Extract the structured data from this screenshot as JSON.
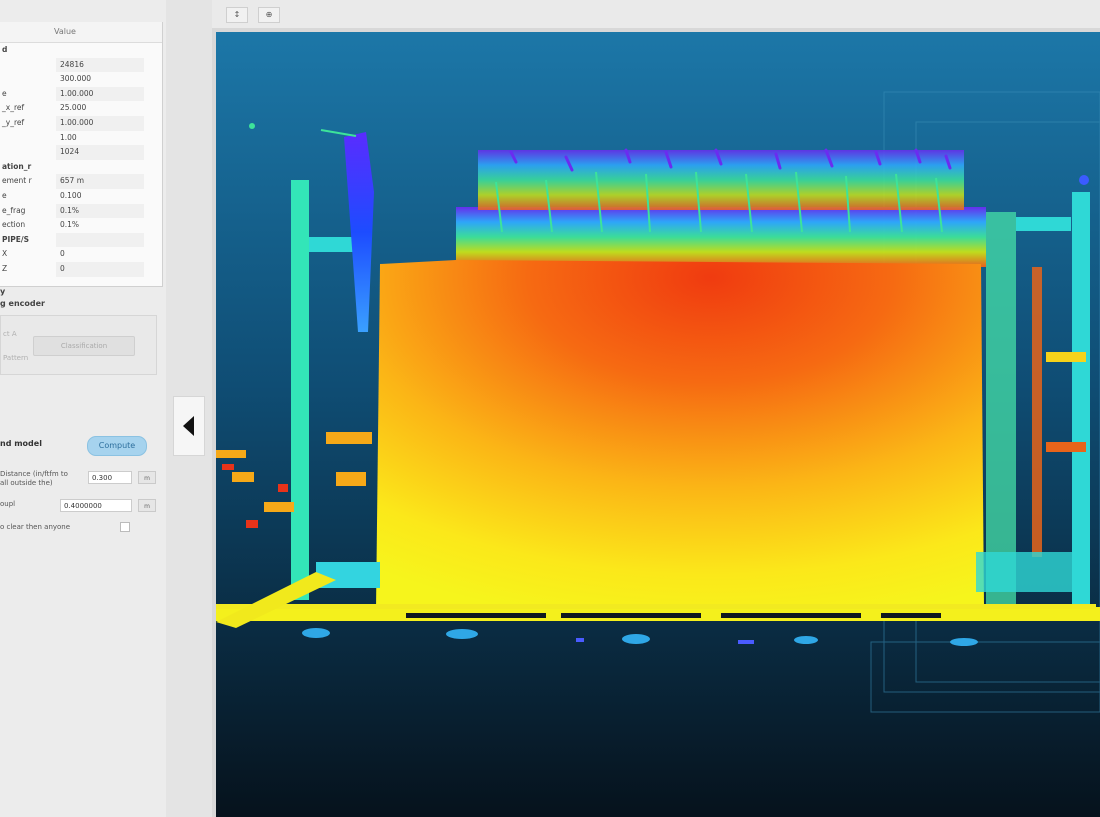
{
  "left_panel": {
    "title": "",
    "table": {
      "col_name": "",
      "col_value": "Value",
      "rows": [
        {
          "k": "d",
          "v": "",
          "section": true
        },
        {
          "k": "",
          "v": "24816"
        },
        {
          "k": "",
          "v": "300.000"
        },
        {
          "k": "e",
          "v": "1.00.000"
        },
        {
          "k": "_x_ref",
          "v": "25.000"
        },
        {
          "k": "_y_ref",
          "v": "1.00.000"
        },
        {
          "k": "",
          "v": "1.00"
        },
        {
          "k": "",
          "v": "1024"
        },
        {
          "k": "ation_r",
          "v": "",
          "section": true
        },
        {
          "k": "ement r",
          "v": "657 m"
        },
        {
          "k": "e",
          "v": "0.100"
        },
        {
          "k": "e_frag",
          "v": "0.1%"
        },
        {
          "k": "ection",
          "v": "0.1%"
        },
        {
          "k": "PIPE/S",
          "v": "",
          "section": true
        },
        {
          "k": "X",
          "v": "0"
        },
        {
          "k": "Z",
          "v": "0"
        }
      ]
    },
    "method": {
      "label_1": "y",
      "label_2": "g encoder",
      "faded_1": "ct A",
      "faded_2": "Pattern",
      "button_label": "Classification"
    },
    "ground": {
      "label": "nd model",
      "compute_label": "Compute"
    },
    "params": {
      "distance_label_1": "Distance (in/ftfm to",
      "distance_label_2": "all outside the)",
      "distance_value": "0.300",
      "threshold_label": "oupl",
      "threshold_value": "0.4000000",
      "clear_label": "o clear then anyone",
      "unit": "m"
    }
  },
  "toolbar": {
    "btn_1": "↕",
    "btn_2": "⊕"
  },
  "viewport": {
    "bg_top": "#1c77a8",
    "bg_bottom": "#06121c"
  }
}
